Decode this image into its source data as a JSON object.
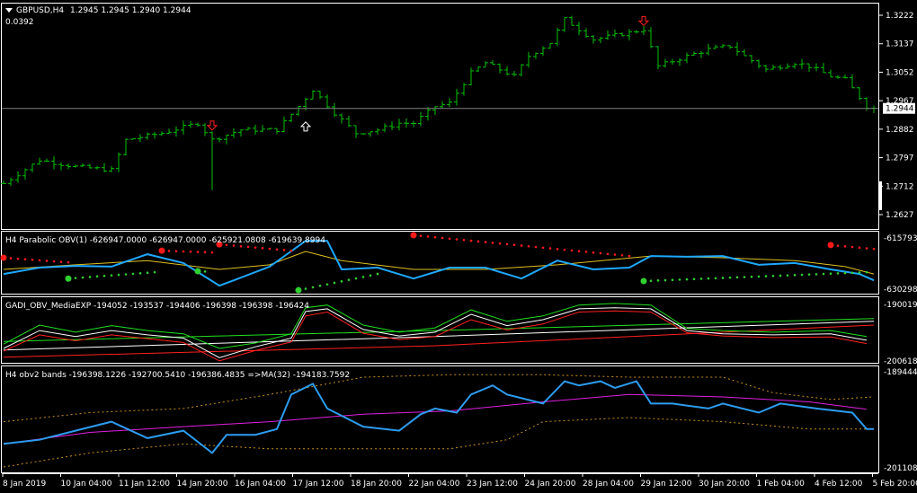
{
  "main": {
    "symbol_label": "GBPUSD,H4",
    "ohlc": "1.2945 1.2945 1.2940 1.2944",
    "sub_value": "0.0392",
    "current_price": "1.2944",
    "price_ticks": [
      "1.3222",
      "1.3137",
      "1.3052",
      "1.2967",
      "1.2882",
      "1.2797",
      "1.2712",
      "1.2627"
    ],
    "price_range": [
      1.2627,
      1.3222
    ],
    "bar_count": 122,
    "close_keypoints": [
      [
        0,
        1.272
      ],
      [
        5,
        1.279
      ],
      [
        10,
        1.277
      ],
      [
        15,
        1.276
      ],
      [
        17,
        1.285
      ],
      [
        22,
        1.287
      ],
      [
        27,
        1.29
      ],
      [
        29,
        1.285
      ],
      [
        33,
        1.288
      ],
      [
        38,
        1.288
      ],
      [
        41,
        1.295
      ],
      [
        43,
        1.3
      ],
      [
        46,
        1.293
      ],
      [
        49,
        1.287
      ],
      [
        52,
        1.288
      ],
      [
        55,
        1.29
      ],
      [
        57,
        1.29
      ],
      [
        60,
        1.295
      ],
      [
        62,
        1.296
      ],
      [
        65,
        1.305
      ],
      [
        67,
        1.308
      ],
      [
        71,
        1.304
      ],
      [
        73,
        1.31
      ],
      [
        76,
        1.314
      ],
      [
        78,
        1.321
      ],
      [
        82,
        1.315
      ],
      [
        87,
        1.317
      ],
      [
        89,
        1.318
      ],
      [
        91,
        1.307
      ],
      [
        95,
        1.31
      ],
      [
        98,
        1.312
      ],
      [
        101,
        1.313
      ],
      [
        103,
        1.31
      ],
      [
        106,
        1.306
      ],
      [
        110,
        1.308
      ],
      [
        112,
        1.307
      ],
      [
        115,
        1.304
      ],
      [
        117,
        1.303
      ],
      [
        120,
        1.295
      ],
      [
        121,
        1.2944
      ]
    ],
    "arrows": [
      {
        "bar": 29,
        "price": 1.2893,
        "dir": "down",
        "color": "#ff2020"
      },
      {
        "bar": 42,
        "price": 1.289,
        "dir": "up",
        "color": "#ffffff"
      },
      {
        "bar": 89,
        "price": 1.3205,
        "dir": "down",
        "color": "#ff2020"
      }
    ],
    "colors": {
      "bars": "#00c000",
      "price_line": "#808080"
    }
  },
  "obv": {
    "label": "H4 Parabolic OBV(1) -626947.0000 -626947.0000 -625921.0808 -619639.8994",
    "ticks": [
      "-615793.7",
      "-630298.3"
    ],
    "range_k": [
      -630.298,
      -615.793
    ],
    "obv_k": [
      [
        0,
        -626.0
      ],
      [
        5,
        -624.2
      ],
      [
        10,
        -623.7
      ],
      [
        15,
        -623.9
      ],
      [
        20,
        -620.4
      ],
      [
        25,
        -622.9
      ],
      [
        30,
        -629.3
      ],
      [
        32,
        -627.8
      ],
      [
        37,
        -623.9
      ],
      [
        42,
        -616.6
      ],
      [
        45,
        -616.6
      ],
      [
        47,
        -624.7
      ],
      [
        52,
        -624.2
      ],
      [
        57,
        -627.3
      ],
      [
        62,
        -624.2
      ],
      [
        67,
        -624.2
      ],
      [
        72,
        -627.3
      ],
      [
        77,
        -622.2
      ],
      [
        82,
        -624.7
      ],
      [
        87,
        -624.2
      ],
      [
        90,
        -620.9
      ],
      [
        95,
        -621.1
      ],
      [
        100,
        -620.9
      ],
      [
        105,
        -623.4
      ],
      [
        110,
        -622.9
      ],
      [
        115,
        -624.7
      ],
      [
        119,
        -626.0
      ],
      [
        121,
        -627.8
      ]
    ],
    "ma_k": [
      [
        0,
        -624.7
      ],
      [
        10,
        -623.4
      ],
      [
        20,
        -622.2
      ],
      [
        30,
        -624.7
      ],
      [
        37,
        -623.4
      ],
      [
        42,
        -619.6
      ],
      [
        47,
        -622.2
      ],
      [
        57,
        -624.7
      ],
      [
        67,
        -624.7
      ],
      [
        77,
        -623.4
      ],
      [
        90,
        -620.9
      ],
      [
        100,
        -621.4
      ],
      [
        110,
        -622.2
      ],
      [
        117,
        -623.9
      ],
      [
        121,
        -626.0
      ]
    ],
    "sar_segments": [
      {
        "from": [
          0,
          -621.4
        ],
        "to": [
          9,
          -622.7
        ],
        "color": "#ff1a1a"
      },
      {
        "from": [
          22,
          -619.4
        ],
        "to": [
          29,
          -619.9
        ],
        "color": "#ff1a1a"
      },
      {
        "from": [
          30,
          -617.6
        ],
        "to": [
          40,
          -619.4
        ],
        "color": "#ff1a1a"
      },
      {
        "from": [
          57,
          -615.0
        ],
        "to": [
          87,
          -620.9
        ],
        "color": "#ff1a1a"
      },
      {
        "from": [
          115,
          -617.8
        ],
        "to": [
          121,
          -618.9
        ],
        "color": "#ff1a1a"
      },
      {
        "from": [
          9,
          -627.3
        ],
        "to": [
          21,
          -625.5
        ],
        "color": "#30d030"
      },
      {
        "from": [
          27,
          -625.2
        ],
        "to": [
          28,
          -625.3
        ],
        "color": "#30d030"
      },
      {
        "from": [
          41,
          -630.6
        ],
        "to": [
          52,
          -626.0
        ],
        "color": "#30d030"
      },
      {
        "from": [
          89,
          -628.0
        ],
        "to": [
          120,
          -625.5
        ],
        "color": "#30d030"
      }
    ],
    "colors": {
      "obv": "#1ea8ff",
      "ma": "#e0c020"
    }
  },
  "gadi": {
    "label": "GADI_OBV_MediaEXP -194052 -193537 -194406 -196398 -196398 -196424",
    "ticks": [
      "-190019",
      "-200618"
    ],
    "range_k": [
      -200.618,
      -190.019
    ],
    "bars": [
      0,
      5,
      10,
      15,
      20,
      25,
      30,
      35,
      40,
      42,
      45,
      50,
      55,
      60,
      65,
      70,
      75,
      80,
      85,
      90,
      95,
      100,
      107,
      115,
      120
    ],
    "fast_green_k": [
      -197.5,
      -194.0,
      -195.3,
      -194.1,
      -195.0,
      -195.6,
      -198.3,
      -197.3,
      -195.6,
      -190.8,
      -190.3,
      -194.0,
      -195.3,
      -194.5,
      -191.2,
      -193.3,
      -192.3,
      -190.3,
      -190.0,
      -190.3,
      -194.6,
      -195.0,
      -195.3,
      -195.0,
      -196.1
    ],
    "fast_white_k": [
      -198.3,
      -195.0,
      -196.1,
      -195.0,
      -195.8,
      -196.4,
      -200.0,
      -198.0,
      -196.4,
      -191.5,
      -191.0,
      -194.8,
      -196.0,
      -195.3,
      -192.0,
      -194.1,
      -193.0,
      -191.0,
      -190.8,
      -191.0,
      -195.0,
      -195.6,
      -195.8,
      -195.6,
      -196.8
    ],
    "fast_red_k": [
      -198.8,
      -195.8,
      -196.9,
      -195.8,
      -196.5,
      -197.2,
      -200.6,
      -198.7,
      -197.1,
      -192.3,
      -191.6,
      -195.5,
      -196.7,
      -196.1,
      -193.0,
      -194.9,
      -193.8,
      -191.6,
      -191.4,
      -191.6,
      -195.4,
      -196.0,
      -196.3,
      -196.2,
      -197.4
    ],
    "slow_green_k": [
      [
        0,
        -197.0
      ],
      [
        60,
        -195.0
      ],
      [
        121,
        -192.8
      ]
    ],
    "slow_white_k": [
      [
        0,
        -198.6
      ],
      [
        60,
        -196.1
      ],
      [
        121,
        -193.3
      ]
    ],
    "slow_red_k": [
      [
        0,
        -199.9
      ],
      [
        60,
        -197.8
      ],
      [
        121,
        -194.0
      ]
    ],
    "colors": {
      "green": "#20e020",
      "white": "#ffffff",
      "red": "#ff2020"
    }
  },
  "bands": {
    "label": "H4 obv2 bands -196398.1226 -192700.5410 -196386.4835  =>MA(32) -194183.7592",
    "ticks": [
      "-189444.6",
      "-201108.6"
    ],
    "range_k": [
      -201.108,
      -189.444
    ],
    "obv_k": [
      [
        0,
        -198.2
      ],
      [
        5,
        -197.7
      ],
      [
        10,
        -196.6
      ],
      [
        15,
        -195.5
      ],
      [
        20,
        -197.5
      ],
      [
        25,
        -196.6
      ],
      [
        29,
        -199.3
      ],
      [
        31,
        -197.1
      ],
      [
        35,
        -197.1
      ],
      [
        38,
        -196.4
      ],
      [
        40,
        -192.2
      ],
      [
        43,
        -190.9
      ],
      [
        45,
        -193.9
      ],
      [
        50,
        -196.1
      ],
      [
        55,
        -196.6
      ],
      [
        58,
        -194.6
      ],
      [
        60,
        -193.9
      ],
      [
        63,
        -194.4
      ],
      [
        65,
        -192.2
      ],
      [
        68,
        -191.1
      ],
      [
        70,
        -192.2
      ],
      [
        75,
        -193.3
      ],
      [
        78,
        -190.6
      ],
      [
        80,
        -191.1
      ],
      [
        83,
        -190.6
      ],
      [
        85,
        -191.4
      ],
      [
        88,
        -190.6
      ],
      [
        90,
        -193.3
      ],
      [
        93,
        -193.3
      ],
      [
        98,
        -193.9
      ],
      [
        100,
        -193.3
      ],
      [
        105,
        -194.4
      ],
      [
        108,
        -193.3
      ],
      [
        113,
        -193.9
      ],
      [
        118,
        -194.4
      ],
      [
        120,
        -196.4
      ],
      [
        121,
        -196.4
      ]
    ],
    "ma_k": [
      [
        0,
        -198.2
      ],
      [
        12,
        -196.8
      ],
      [
        25,
        -196.1
      ],
      [
        37,
        -195.5
      ],
      [
        50,
        -194.6
      ],
      [
        62,
        -194.2
      ],
      [
        75,
        -193.1
      ],
      [
        87,
        -192.2
      ],
      [
        100,
        -192.5
      ],
      [
        112,
        -193.1
      ],
      [
        120,
        -194.0
      ]
    ],
    "upper_k": [
      [
        0,
        -195.5
      ],
      [
        12,
        -194.4
      ],
      [
        25,
        -193.9
      ],
      [
        37,
        -192.2
      ],
      [
        50,
        -190.1
      ],
      [
        62,
        -189.8
      ],
      [
        75,
        -189.8
      ],
      [
        87,
        -190.1
      ],
      [
        100,
        -190.1
      ],
      [
        107,
        -192.0
      ],
      [
        115,
        -192.8
      ],
      [
        121,
        -192.5
      ]
    ],
    "lower_k": [
      [
        0,
        -201.0
      ],
      [
        12,
        -199.3
      ],
      [
        25,
        -198.2
      ],
      [
        37,
        -198.8
      ],
      [
        50,
        -198.8
      ],
      [
        62,
        -198.8
      ],
      [
        70,
        -197.7
      ],
      [
        75,
        -195.5
      ],
      [
        87,
        -195.0
      ],
      [
        100,
        -195.5
      ],
      [
        112,
        -196.4
      ],
      [
        121,
        -196.4
      ]
    ],
    "colors": {
      "obv": "#2d9cf0",
      "ma": "#e020e0",
      "band": "#c89020"
    }
  },
  "time_axis": [
    "8 Jan 2019",
    "10 Jan 04:00",
    "11 Jan 12:00",
    "14 Jan 20:00",
    "16 Jan 04:00",
    "17 Jan 12:00",
    "18 Jan 20:00",
    "22 Jan 04:00",
    "23 Jan 12:00",
    "24 Jan 20:00",
    "28 Jan 04:00",
    "29 Jan 12:00",
    "30 Jan 20:00",
    "1 Feb 04:00",
    "4 Feb 12:00",
    "5 Feb 20:00"
  ]
}
